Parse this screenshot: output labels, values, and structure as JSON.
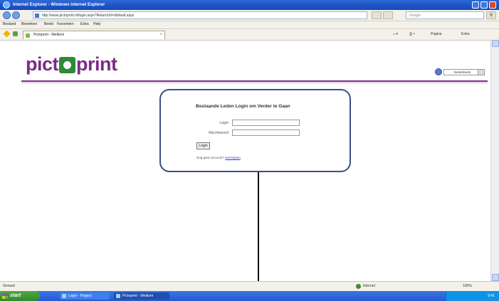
{
  "window": {
    "title": "Internet Explorer - Windows Internet Explorer"
  },
  "address_bar": {
    "url": "http://www.pictoprint.nl/login.aspx?ReturnUrl=/default.aspx",
    "search_placeholder": "Google"
  },
  "menu": {
    "items": [
      "Bestand",
      "Bewerken",
      "Beeld",
      "Favorieten",
      "Extra",
      "Help"
    ]
  },
  "tab": {
    "label": "Pictoprint - Welkom",
    "page_label": "Pagina",
    "tools_label": "Extra"
  },
  "page": {
    "logo_before": "pict",
    "logo_after": "print",
    "language_label": "Nederlands"
  },
  "login": {
    "heading": "Bestaande Leden Login om Verder te Gaan",
    "login_label": "Login:",
    "password_label": "Wachtwoord:",
    "button_label": "Login",
    "no_account_text": "Nog geen account?",
    "signup_link": "Inschrijven"
  },
  "status_bar": {
    "status_text": "Gereed",
    "zone": "Internet",
    "zoom": "100%"
  },
  "taskbar": {
    "start_label": "start",
    "tasks": [
      "Login - Project",
      "Pictoprint - Welkom"
    ],
    "clock": "9:41"
  }
}
